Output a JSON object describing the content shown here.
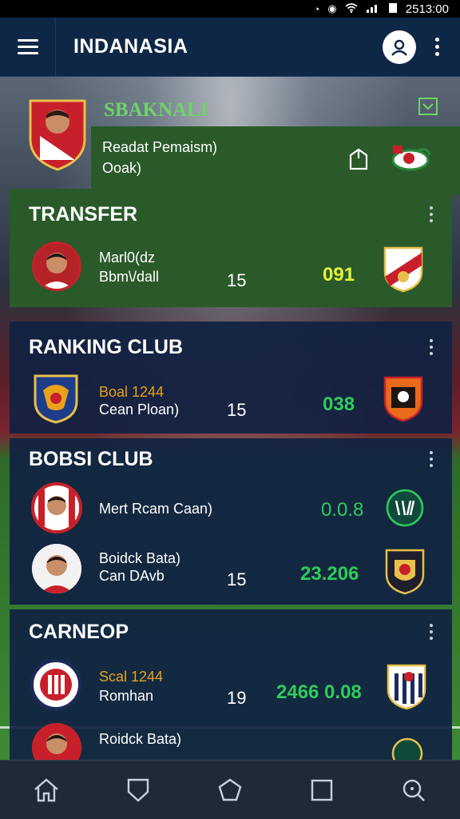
{
  "status_bar": {
    "left_glyphs": "0  ",
    "time": "2513:00"
  },
  "app_bar": {
    "title": "INDANASIA"
  },
  "profile": {
    "name": "SBAKNALI",
    "line1": "Readat Pemaism)",
    "line2": "Ooak)"
  },
  "sections": [
    {
      "title": "TRANSFER",
      "rows": [
        {
          "line1": "Marl0(dz",
          "line2": "Bbm\\/dall",
          "number": "15",
          "score": "091",
          "score_color": "#e3f23a"
        }
      ]
    },
    {
      "title": "RANKING CLUB",
      "rows": [
        {
          "line1": "Boal 1244",
          "line2": "Cean Ploan)",
          "number": "15",
          "score": "038",
          "score_color": "#2ecc5a"
        }
      ]
    },
    {
      "title": "BOBSI CLUB",
      "rows": [
        {
          "line1": "Mert Rcam Caan)",
          "line2": "",
          "number": "",
          "score": "0.0.8",
          "score_color": "#2ecc5a"
        },
        {
          "line1": "Boidck Bata)",
          "line2": "Can DAvb",
          "number": "15",
          "score": "23.206",
          "score_color": "#2ecc5a"
        }
      ]
    },
    {
      "title": "CARNEOP",
      "rows": [
        {
          "line1": "Scal 1244",
          "line2": "Romhan",
          "number": "19",
          "score": "2466 0.08",
          "score_color": "#2ecc5a"
        },
        {
          "line1": "Roidck Bata)",
          "line2": "",
          "number": "",
          "score": "",
          "score_color": "#2ecc5a"
        }
      ]
    }
  ],
  "nav": [
    "home-icon",
    "shield-icon",
    "pentagon-icon",
    "square-icon",
    "search-icon"
  ],
  "colors": {
    "accent_green": "#6ed36a",
    "score_green": "#2ecc5a",
    "score_yellow": "#e3f23a",
    "app_bar": "#0f2747"
  }
}
